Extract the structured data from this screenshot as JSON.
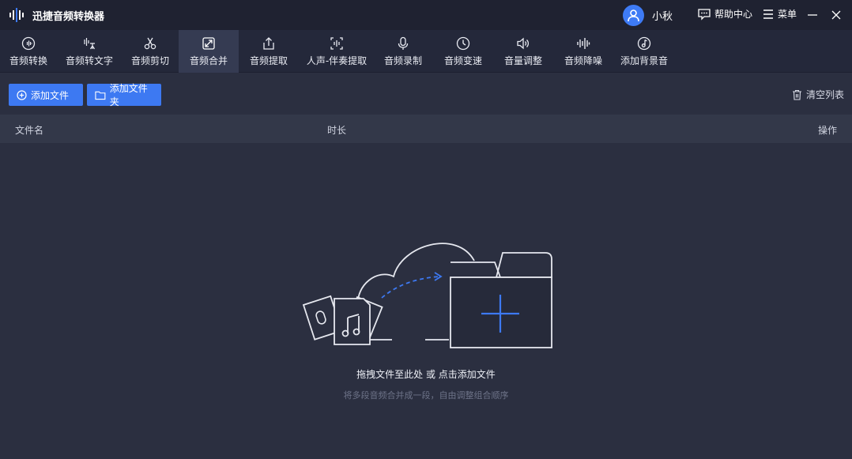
{
  "app": {
    "title": "迅捷音频转换器"
  },
  "user": {
    "name": "小秋"
  },
  "header": {
    "help_label": "帮助中心",
    "menu_label": "菜单"
  },
  "tools": [
    {
      "label": "音频转换",
      "icon": "waveform-icon"
    },
    {
      "label": "音频转文字",
      "icon": "speech-to-text-icon"
    },
    {
      "label": "音频剪切",
      "icon": "scissors-icon"
    },
    {
      "label": "音频合并",
      "icon": "merge-icon",
      "active": true
    },
    {
      "label": "音频提取",
      "icon": "export-icon"
    },
    {
      "label": "人声-伴奏提取",
      "icon": "vocal-separate-icon"
    },
    {
      "label": "音频录制",
      "icon": "microphone-icon"
    },
    {
      "label": "音频变速",
      "icon": "speedometer-icon"
    },
    {
      "label": "音量调整",
      "icon": "volume-icon"
    },
    {
      "label": "音频降噪",
      "icon": "denoise-icon"
    },
    {
      "label": "添加背景音",
      "icon": "music-note-icon"
    }
  ],
  "actions": {
    "add_file": "添加文件",
    "add_folder": "添加文件夹",
    "clear_list": "清空列表"
  },
  "table": {
    "col_name": "文件名",
    "col_duration": "时长",
    "col_action": "操作"
  },
  "dropzone": {
    "hint": "拖拽文件至此处 或 点击添加文件",
    "sub_hint": "将多段音频合并成一段，自由调整组合顺序"
  },
  "colors": {
    "accent": "#3d79f2",
    "background": "#2b2f40",
    "titlebar": "#1f2231",
    "toolbar": "#24283a"
  }
}
